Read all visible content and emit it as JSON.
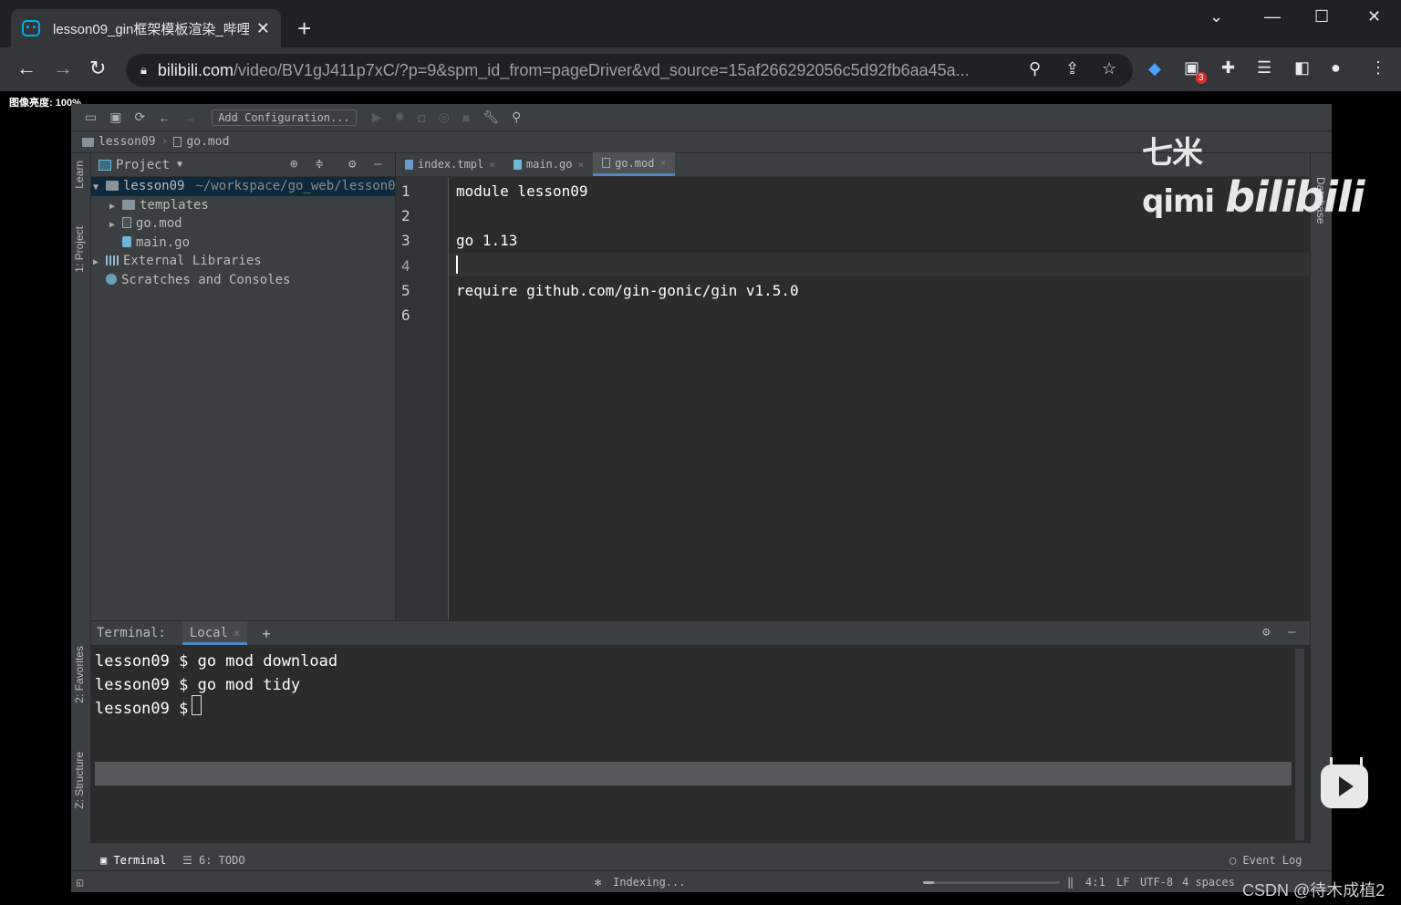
{
  "browser": {
    "tab_title": "lesson09_gin框架模板渲染_哔哩",
    "tab_close": "✕",
    "new_tab": "+",
    "url_domain": "bilibili.com",
    "url_rest": "/video/BV1gJ411p7xC/?p=9&spm_id_from=pageDriver&vd_source=15af266292056c5d92fb6aa45a...",
    "extension_badge": "3",
    "icons": [
      "back-icon",
      "forward-icon",
      "reload-icon",
      "lock-icon",
      "zoom-icon",
      "share-icon",
      "star-icon",
      "extensions-icon",
      "media-icon",
      "sidepanel-icon",
      "profile-icon",
      "menu-icon"
    ]
  },
  "overlay": {
    "brightness_label": "图像亮度: 100%",
    "watermark_text": "七米qimi",
    "watermark_logo": "bilibili",
    "csdn_credit": "CSDN @待木成植2"
  },
  "ide": {
    "toolbar": {
      "add_config": "Add Configuration..."
    },
    "breadcrumb": {
      "project": "lesson09",
      "file": "go.mod"
    },
    "left_tabs": {
      "learn": "Learn",
      "project": "1: Project",
      "favorites": "2: Favorites",
      "structure": "Z: Structure"
    },
    "right_tabs": {
      "database": "Database"
    },
    "project_panel": {
      "title": "Project",
      "tree": [
        {
          "label": "lesson09",
          "path": "~/workspace/go_web/lesson0",
          "arrow": "▼",
          "type": "folder"
        },
        {
          "label": "templates",
          "arrow": "▶",
          "type": "folder"
        },
        {
          "label": "go.mod",
          "arrow": "▶",
          "type": "mod"
        },
        {
          "label": "main.go",
          "arrow": "",
          "type": "go"
        },
        {
          "label": "External Libraries",
          "arrow": "▶",
          "type": "lib"
        },
        {
          "label": "Scratches and Consoles",
          "arrow": "",
          "type": "scratch"
        }
      ]
    },
    "editor_tabs": [
      {
        "label": "index.tmpl",
        "close": "×"
      },
      {
        "label": "main.go",
        "close": "×"
      },
      {
        "label": "go.mod",
        "close": "×"
      }
    ],
    "editor": {
      "line_numbers": [
        "1",
        "2",
        "3",
        "4",
        "5",
        "6"
      ],
      "lines": [
        "module lesson09",
        "",
        "go 1.13",
        "",
        "require github.com/gin-gonic/gin v1.5.0",
        ""
      ]
    },
    "terminal": {
      "label": "Terminal:",
      "tab": "Local",
      "tab_close": "×",
      "add": "+",
      "lines": [
        "lesson09 $ go mod download",
        "lesson09 $ go mod tidy",
        "lesson09 $ "
      ]
    },
    "bottom_tabs": {
      "terminal": "Terminal",
      "todo": "6: TODO",
      "event_log": "Event Log"
    },
    "status": {
      "indexing": "Indexing...",
      "position": "4:1",
      "line_sep": "LF",
      "encoding": "UTF-8",
      "indent": "4 spaces"
    }
  }
}
